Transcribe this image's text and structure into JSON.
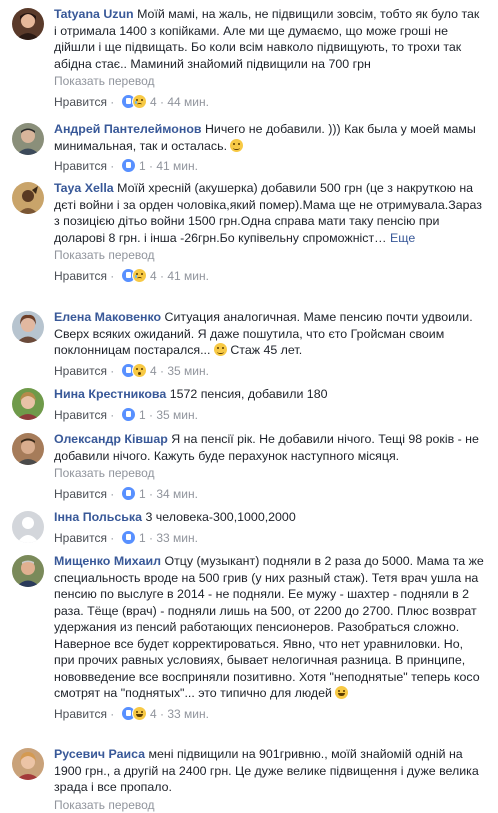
{
  "ui": {
    "like_label": "Нравится",
    "translate_label": "Показать перевод",
    "more_label": "Еще",
    "dot": "·"
  },
  "comments": [
    {
      "author": "Tatyana Uzun",
      "text": "Моїй мамі, на жаль, не підвищили зовсім, тобто як було так і отримала 1400 з копійками. Але ми ще думаємо, що може гроші не дійшли і ще підвищать. Бо коли всім навколо підвищують, то трохи так абідна стає.. Маминий знайомий підвищили на 700 грн",
      "reactions": [
        "like",
        "sad"
      ],
      "count": "4",
      "time": "44 мин."
    },
    {
      "author": "Андрей Пантелеймонов",
      "text": "Ничего не добавили. ))) Как была у моей мамы минимальная, так и осталась.",
      "reactions": [
        "like"
      ],
      "count": "1",
      "time": "41 мин."
    },
    {
      "author": "Taya Xella",
      "text": "Моїй хресній (акушерка) добавили 500 грн (це з накруткою на дєті войни і за орден чоловіка,який помер).Мама ще не отримувала.Зараз з позицією дітьо войни 1500 грн.Одна справа мати таку пенсію при доларові 8 грн. і інша -26грн.Бо купівельну спроможніст…",
      "reactions": [
        "like",
        "sad"
      ],
      "count": "4",
      "time": "41 мин."
    },
    {
      "author": "Елена Маковенко",
      "text": "Ситуация аналогичная. Маме пенсию почти удвоили. Сверх всяких ожиданий. Я даже пошутила, что єто Гройсман своим поклонницам постарался...",
      "text2": " Стаж 45 лет.",
      "reactions": [
        "like",
        "wow"
      ],
      "count": "4",
      "time": "35 мин."
    },
    {
      "author": "Нина Крестникова",
      "text": "1572 пенсия, добавили 180",
      "reactions": [
        "like"
      ],
      "count": "1",
      "time": "35 мин."
    },
    {
      "author": "Олександр Ківшар",
      "text": "Я на пенсії рік. Не добавили нічого. Тещі 98 років - не добавили нічого. Кажуть буде перахунок наступного місяця.",
      "reactions": [
        "like"
      ],
      "count": "1",
      "time": "34 мин."
    },
    {
      "author": "Інна Польська",
      "text": "3 человека-300,1000,2000",
      "reactions": [
        "like"
      ],
      "count": "1",
      "time": "33 мин."
    },
    {
      "author": "Мищенко Михаил",
      "text": "Отцу (музыкант) подняли в 2 раза до 5000. Мама та же специальность вроде на 500 грив (у них разный стаж). Тетя врач ушла на пенсию по выслуге в 2014 - не подняли. Ее мужу - шахтер - подняли в 2 раза. Тёще (врач) - подняли лишь на 500, от 2200 до 2700. Плюс возврат удержания из пенсий работающих пенсионеров. Разобраться сложно. Наверное все будет корректироваться. Явно, что нет уравниловки. Но, при прочих равных условиях, бывает нелогичная разница. В принципе, нововведение все восприняли позитивно. Хотя \"неподнятые\" теперь косо смотрят на \"поднятых\"... это типично для людей",
      "reactions": [
        "like",
        "haha"
      ],
      "count": "4",
      "time": "33 мин."
    },
    {
      "author": "Русевич Раиса",
      "text": "мені підвищили на 901гривню., моїй знайомій одній на 1900 грн., а другій на 2400 грн. Це дуже велике підвищення і дуже велика зрада і все пропало.",
      "reactions": [],
      "count": "",
      "time": ""
    }
  ],
  "colors": {
    "link": "#385898",
    "meta": "#90949c",
    "text": "#1d2129",
    "like_badge": "#5890ff"
  }
}
